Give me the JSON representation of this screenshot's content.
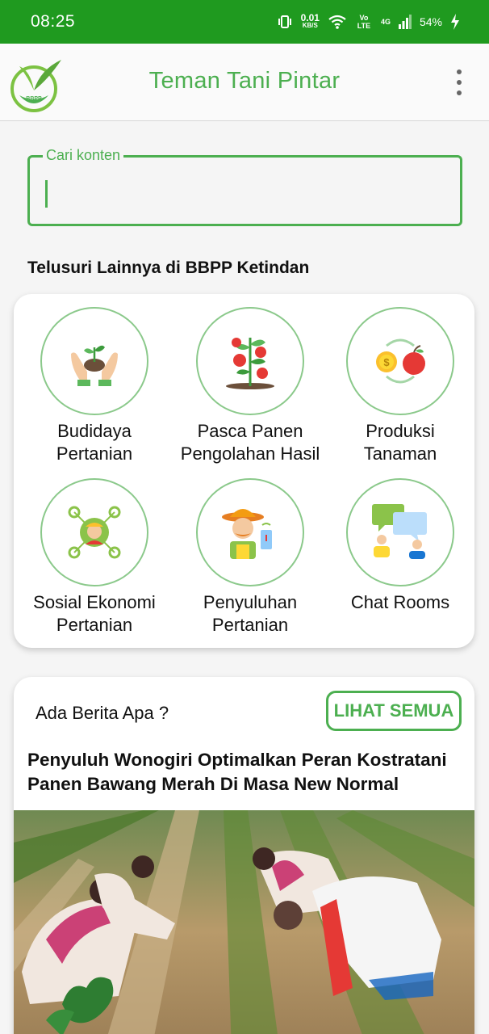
{
  "status_bar": {
    "time": "08:25",
    "speed_value": "0.01",
    "speed_unit": "KB/S",
    "network": "Vo LTE",
    "signal": "4G",
    "battery": "54%"
  },
  "app_bar": {
    "title": "Teman Tani Pintar",
    "logo_text": "BBPP"
  },
  "search": {
    "label": "Cari konten",
    "value": ""
  },
  "explore": {
    "title": "Telusuri Lainnya di BBPP Ketindan",
    "categories": [
      {
        "line1": "Budidaya",
        "line2": "Pertanian"
      },
      {
        "line1": "Pasca Panen",
        "line2": "Pengolahan Hasil"
      },
      {
        "line1": "Produksi",
        "line2": "Tanaman"
      },
      {
        "line1": "Sosial Ekonomi",
        "line2": "Pertanian"
      },
      {
        "line1": "Penyuluhan",
        "line2": "Pertanian"
      },
      {
        "line1": "Chat Rooms",
        "line2": ""
      }
    ]
  },
  "news": {
    "heading": "Ada Berita Apa ?",
    "see_all_label": "LIHAT SEMUA",
    "article_title": "Penyuluh Wonogiri Optimalkan Peran Kostratani Panen Bawang Merah Di Masa New Normal"
  },
  "colors": {
    "primary": "#4caf50",
    "status_bar": "#1f9a1f"
  }
}
